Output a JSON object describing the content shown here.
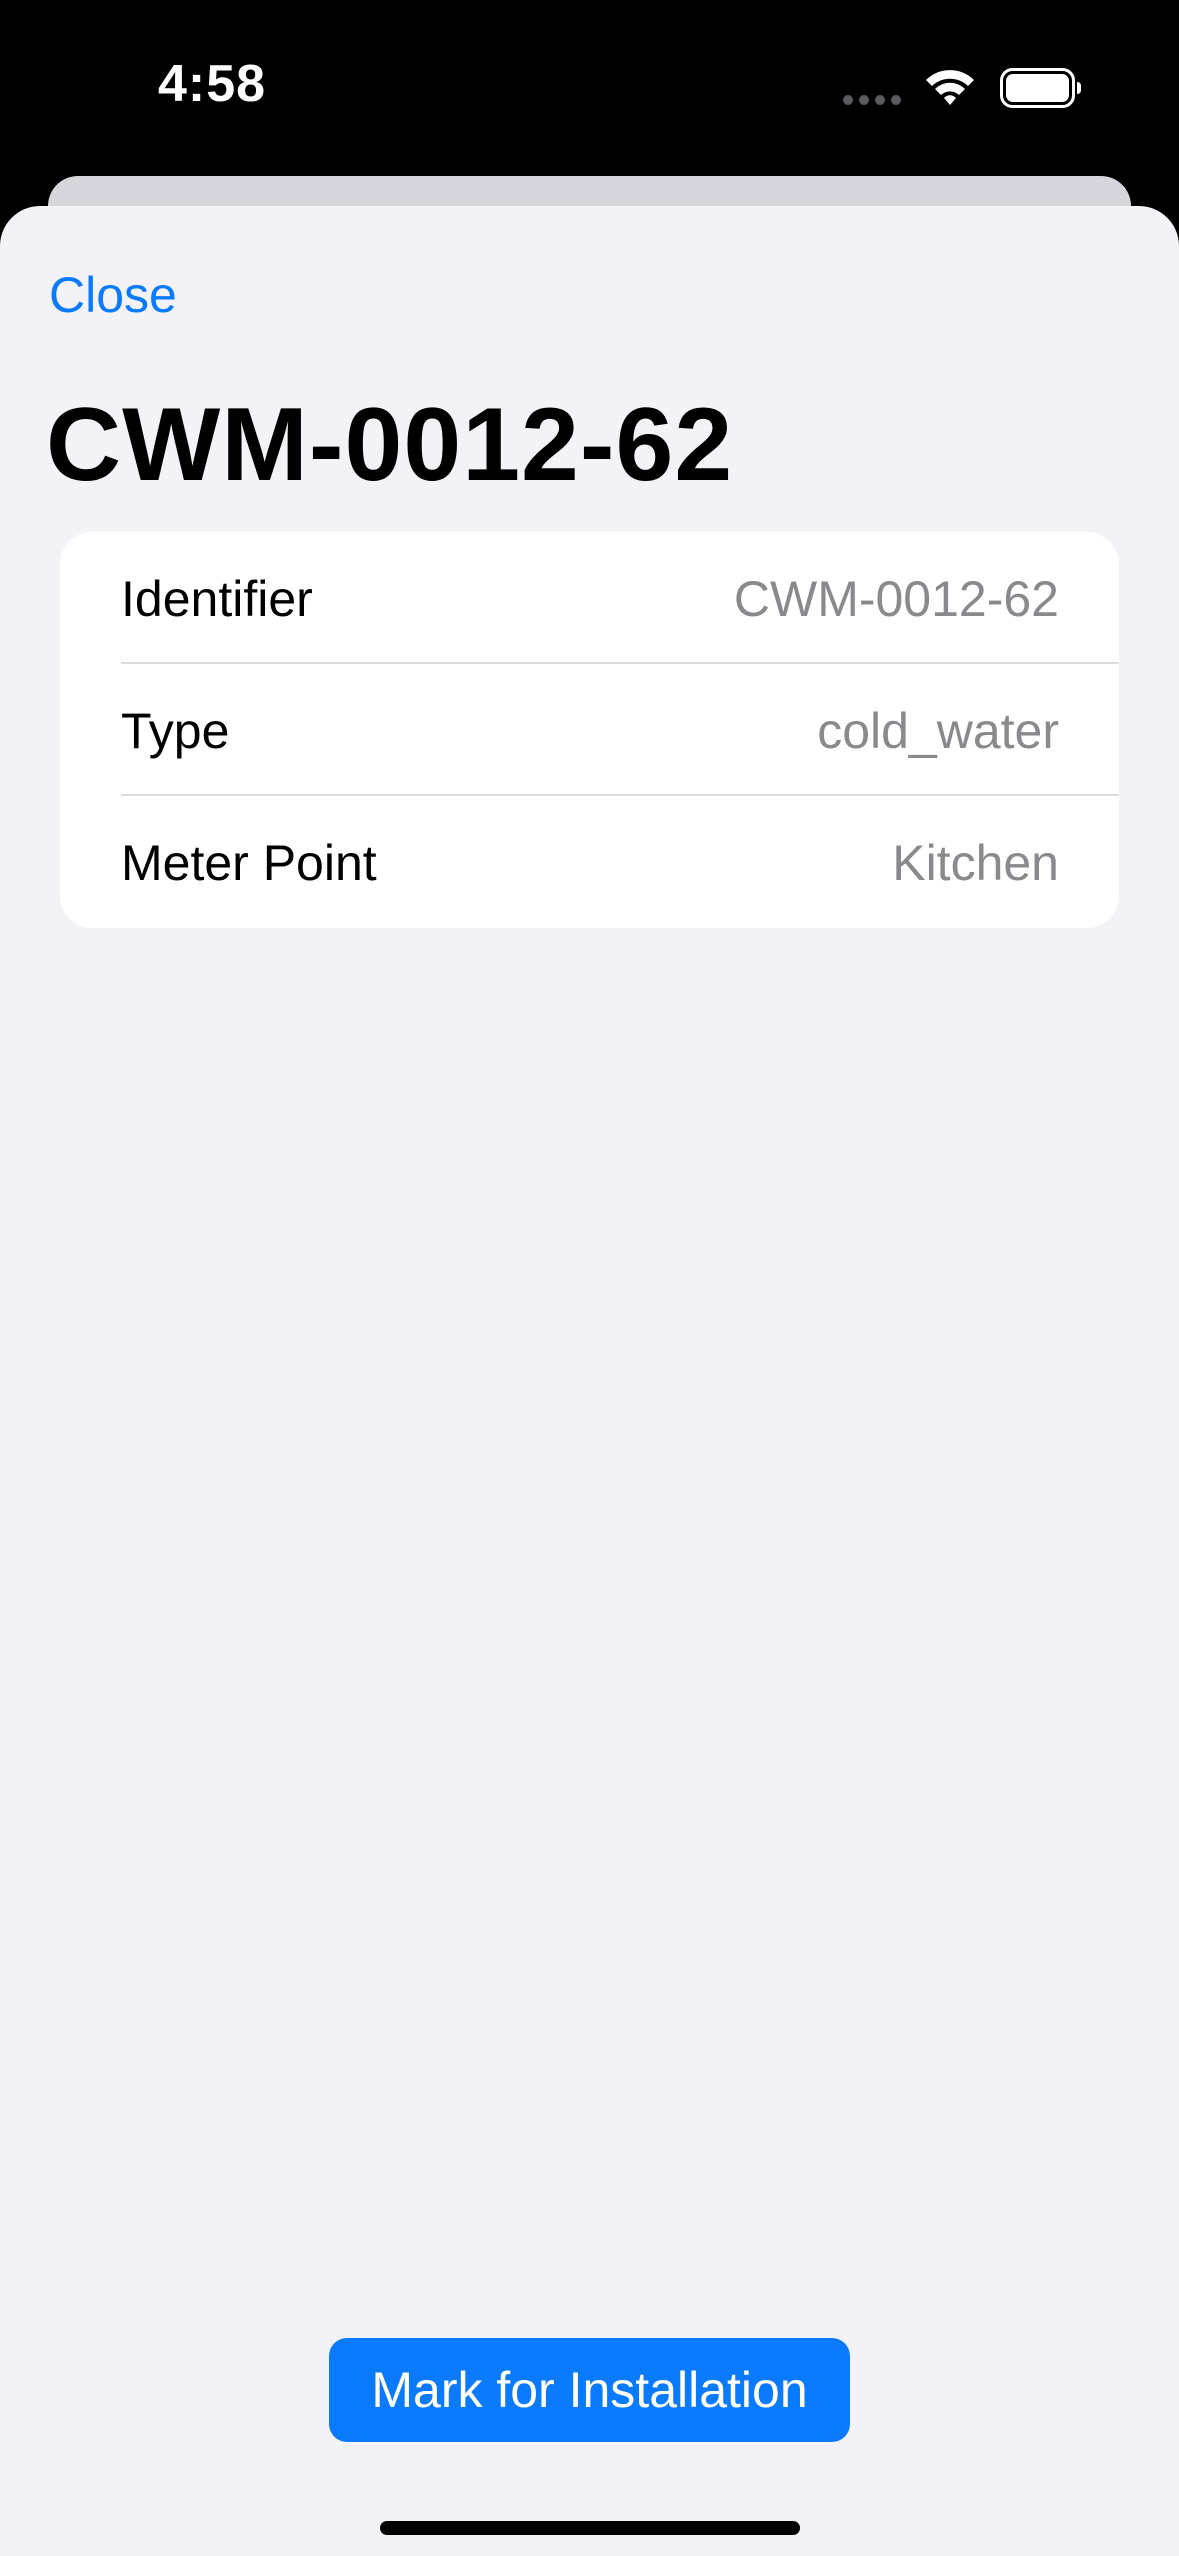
{
  "status_bar": {
    "time": "4:58"
  },
  "header": {
    "close_label": "Close",
    "title": "CWM-0012-62"
  },
  "details": {
    "rows": [
      {
        "label": "Identifier",
        "value": "CWM-0012-62"
      },
      {
        "label": "Type",
        "value": "cold_water"
      },
      {
        "label": "Meter Point",
        "value": "Kitchen"
      }
    ]
  },
  "actions": {
    "primary_label": "Mark for Installation"
  },
  "colors": {
    "accent": "#0a7aff",
    "background": "#f2f2f7",
    "secondary_text": "#8a8a8e"
  },
  "icons": [
    "signal-icon",
    "wifi-icon",
    "battery-icon"
  ]
}
